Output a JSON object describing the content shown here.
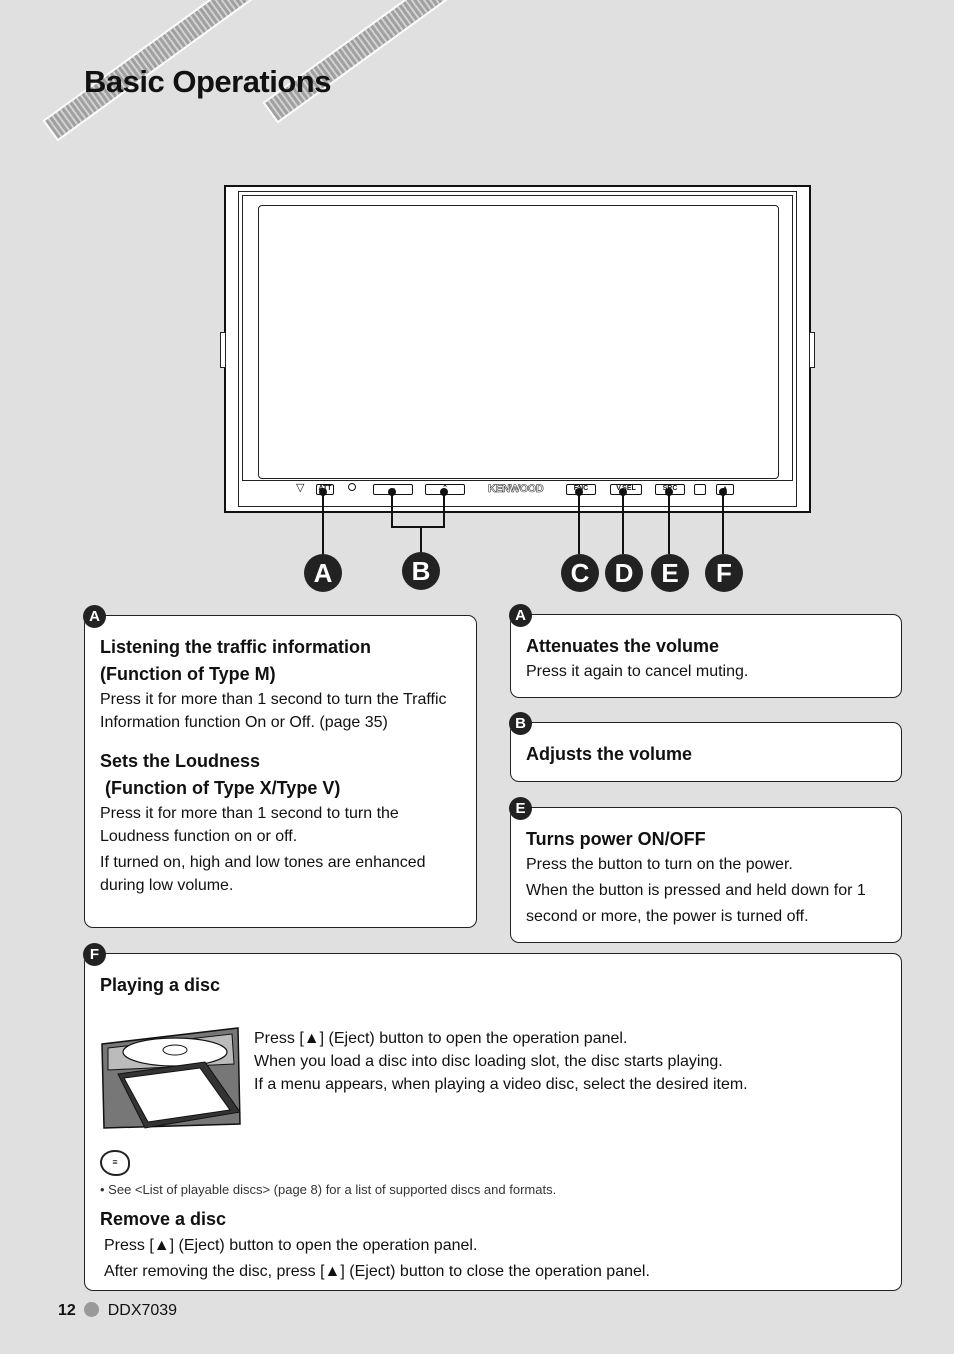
{
  "header": {
    "title": "Basic Operations"
  },
  "device": {
    "brand": "KENWOOD",
    "buttons": {
      "att": "ATT",
      "down": "⌄",
      "up": "⌃",
      "fnc": "FNC",
      "vsel": "V.SEL",
      "src": "SRC",
      "eject": "▲"
    },
    "callouts": [
      "A",
      "B",
      "C",
      "D",
      "E",
      "F"
    ]
  },
  "boxes": {
    "a_left": {
      "badge": "A",
      "heading1": "Listening the traffic information",
      "heading1b": "(Function of Type M)",
      "text1": "Press it for more than 1 second to turn the Traffic Information function On or Off. (page 35)",
      "heading2": "Sets the Loudness",
      "heading2b": "(Function of Type X/Type V)",
      "text2": "Press it for more than 1 second to turn the Loudness function on or off.",
      "text3": "If turned on, high and low tones are enhanced during low volume."
    },
    "a_right": {
      "badge": "A",
      "heading": "Attenuates the volume",
      "text": "Press it again to cancel muting."
    },
    "b": {
      "badge": "B",
      "heading": "Adjusts the volume"
    },
    "e": {
      "badge": "E",
      "heading": "Turns power ON/OFF",
      "text1": "Press the button to turn on the power.",
      "text2": "When the button is pressed and held down for 1 second or more, the power is turned off."
    },
    "f": {
      "badge": "F",
      "heading": "Playing a disc",
      "lines": [
        "Press [▲] (Eject) button to open the operation panel.",
        "When you load a disc into disc loading slot, the disc starts playing.",
        "If a menu appears, when playing a video disc, select the desired item."
      ],
      "note": "See <List of playable discs> (page 8) for a list of supported discs and formats.",
      "heading2": "Remove a disc",
      "lines2": [
        "Press [▲] (Eject) button to open the operation panel.",
        "After removing the disc, press [▲] (Eject) button to close the operation panel."
      ]
    }
  },
  "footer": {
    "page": "12",
    "model": "DDX7039"
  },
  "colors": {
    "page_bg": "#e0e0e0",
    "badge": "#222222"
  }
}
